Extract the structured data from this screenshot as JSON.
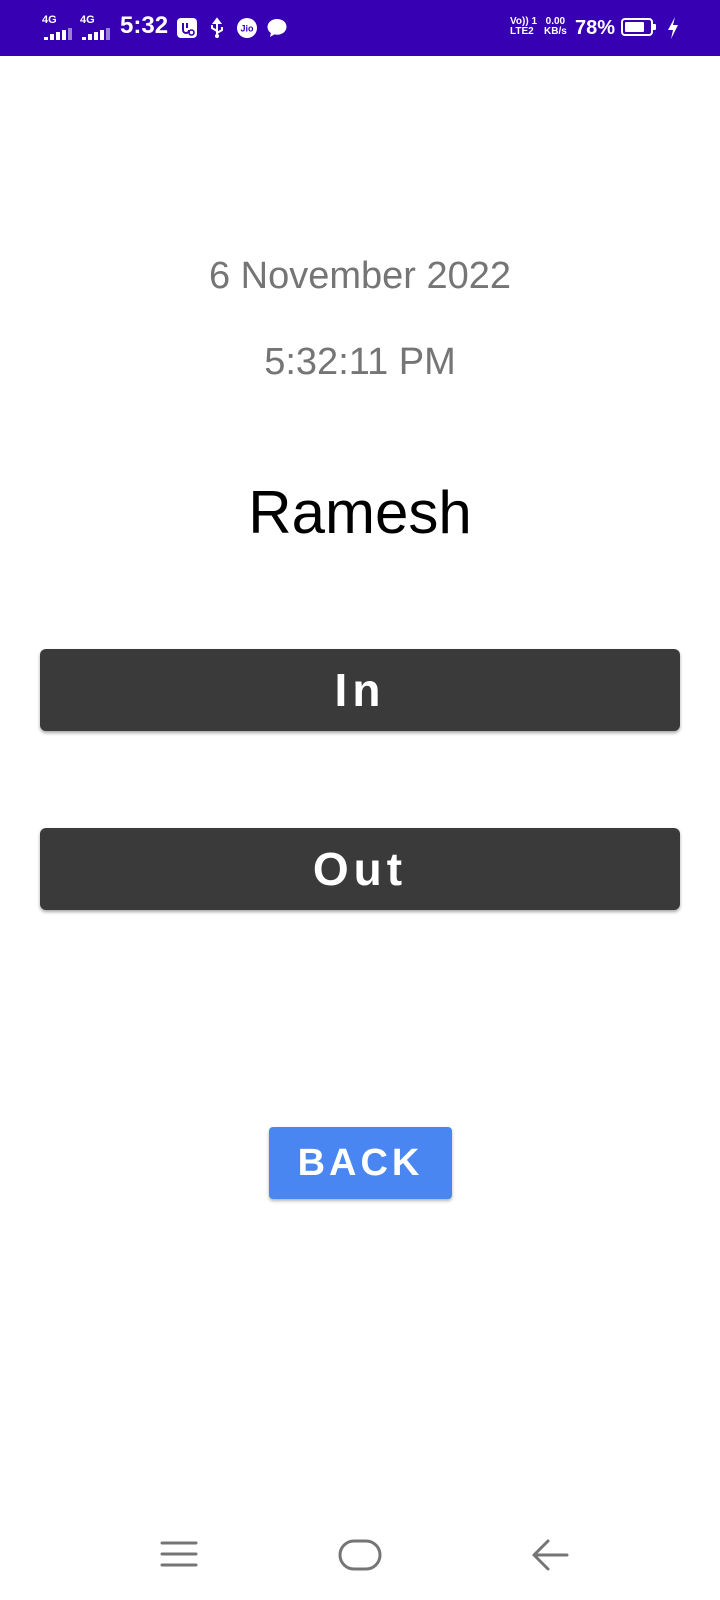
{
  "status_bar": {
    "sim1_network": "4G",
    "sim2_network": "4G",
    "time": "5:32",
    "volte_line1": "Vo)) 1",
    "volte_line2": "LTE2",
    "speed_value": "0.00",
    "speed_unit": "KB/s",
    "battery_percent": "78%",
    "battery_level": 0.78,
    "icons": [
      "signal-icon",
      "signal-icon",
      "usb-debug-icon",
      "usb-icon",
      "jio-icon",
      "chat-icon",
      "battery-icon",
      "charging-icon"
    ],
    "background_color": "#3700b3"
  },
  "main": {
    "date": "6 November 2022",
    "time": "5:32:11 PM",
    "name": "Ramesh",
    "in_label": "In",
    "out_label": "Out",
    "back_label": "BACK"
  },
  "colors": {
    "action_button": "#3a3a3a",
    "back_button": "#4a86f1",
    "secondary_text": "#757575"
  },
  "nav_bar": {
    "icons": [
      "menu-icon",
      "home-icon",
      "back-icon"
    ]
  }
}
